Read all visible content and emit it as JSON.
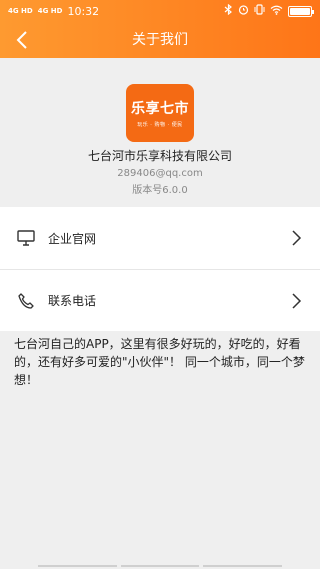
{
  "status": {
    "signal_label_1": "4G HD",
    "signal_label_2": "4G HD",
    "time": "10:32",
    "battery_percent": 100
  },
  "header": {
    "title": "关于我们"
  },
  "logo": {
    "main": "乐享七市",
    "sub": "玩乐 · 购物 · 便民"
  },
  "company": {
    "name": "七台河市乐享科技有限公司",
    "email": "289406@qq.com",
    "version": "版本号6.0.0"
  },
  "menu": {
    "items": [
      {
        "label": "企业官网",
        "icon": "monitor-icon"
      },
      {
        "label": "联系电话",
        "icon": "phone-icon"
      }
    ]
  },
  "description": "七台河自己的APP，这里有很多好玩的，好吃的，好看的，还有好多可爱的\"小伙伴\"！ 同一个城市，同一个梦想！",
  "colors": {
    "accent": "#fe7f20",
    "background": "#efefef"
  }
}
